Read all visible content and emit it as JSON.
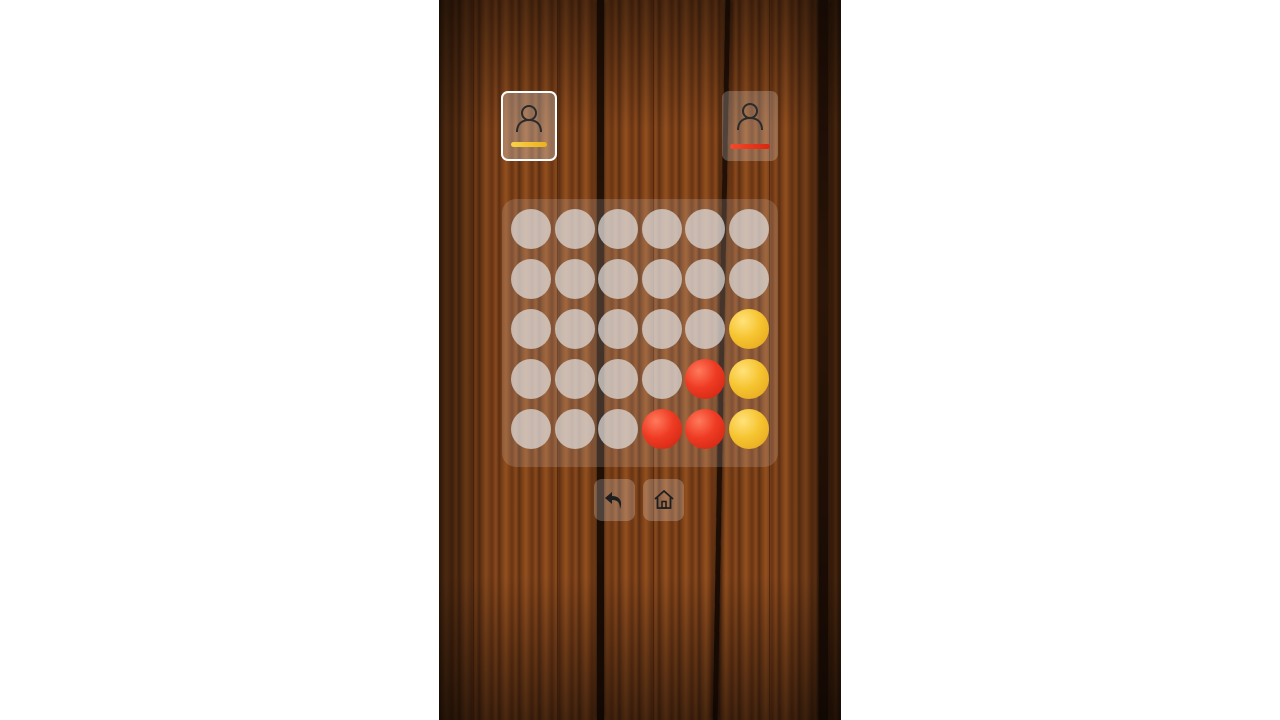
{
  "colors": {
    "player_one": "#f2c12e",
    "player_two": "#ee3a22",
    "empty_slot": "#e1dedc"
  },
  "players": [
    {
      "icon": "person-icon",
      "color": "#f2c12e",
      "active": true
    },
    {
      "icon": "person-icon",
      "color": "#ee3a22",
      "active": false
    }
  ],
  "board": {
    "columns": 6,
    "rows": 5,
    "grid": [
      [
        "empty",
        "empty",
        "empty",
        "empty",
        "empty",
        "empty"
      ],
      [
        "empty",
        "empty",
        "empty",
        "empty",
        "empty",
        "empty"
      ],
      [
        "empty",
        "empty",
        "empty",
        "empty",
        "empty",
        "yellow"
      ],
      [
        "empty",
        "empty",
        "empty",
        "empty",
        "red",
        "yellow"
      ],
      [
        "empty",
        "empty",
        "empty",
        "red",
        "red",
        "yellow"
      ]
    ]
  },
  "controls": [
    {
      "icon": "undo-icon"
    },
    {
      "icon": "home-icon"
    }
  ]
}
